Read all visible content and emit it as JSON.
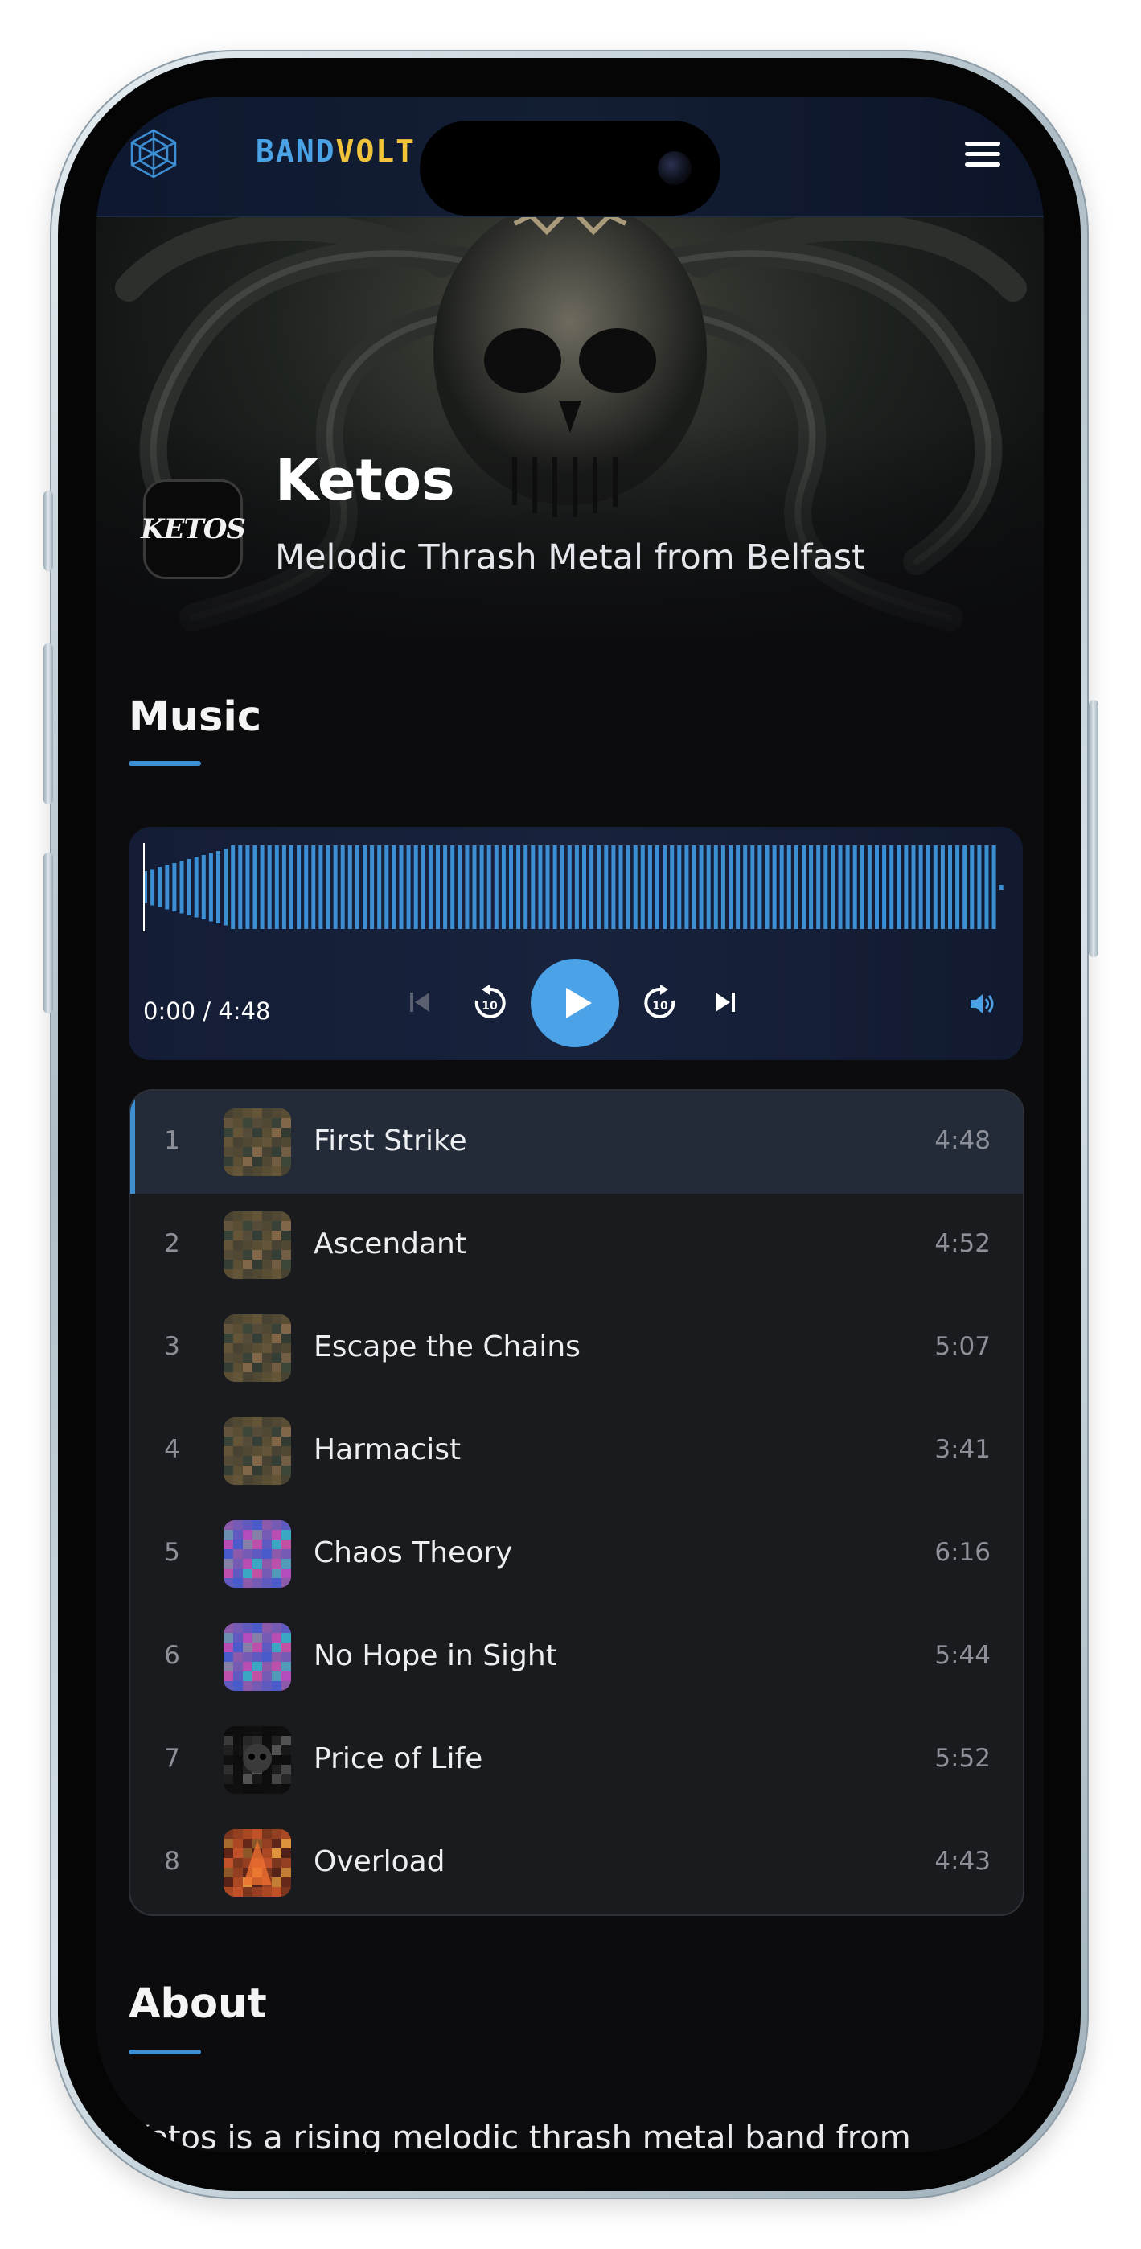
{
  "nav": {
    "brand_part1": "BAND",
    "brand_part2": "VOLT",
    "menu_icon": "hamburger-menu-icon",
    "logo_icon": "cube-logo-icon"
  },
  "hero": {
    "band_logo_text": "KETOS",
    "band_name": "Ketos",
    "tagline": "Melodic Thrash Metal from Belfast"
  },
  "music": {
    "title": "Music",
    "player": {
      "time_display": "0:00 / 4:48",
      "progress": 0,
      "icons": [
        "skip-back-icon",
        "rewind-10-icon",
        "play-icon",
        "forward-10-icon",
        "skip-forward-icon",
        "volume-icon"
      ]
    },
    "tracks": [
      {
        "num": "1",
        "title": "First Strike",
        "duration": "4:48",
        "active": true,
        "art": "album-a"
      },
      {
        "num": "2",
        "title": "Ascendant",
        "duration": "4:52",
        "active": false,
        "art": "album-a"
      },
      {
        "num": "3",
        "title": "Escape the Chains",
        "duration": "5:07",
        "active": false,
        "art": "album-a"
      },
      {
        "num": "4",
        "title": "Harmacist",
        "duration": "3:41",
        "active": false,
        "art": "album-a"
      },
      {
        "num": "5",
        "title": "Chaos Theory",
        "duration": "6:16",
        "active": false,
        "art": "album-b"
      },
      {
        "num": "6",
        "title": "No Hope in Sight",
        "duration": "5:44",
        "active": false,
        "art": "album-b"
      },
      {
        "num": "7",
        "title": "Price of Life",
        "duration": "5:52",
        "active": false,
        "art": "album-c"
      },
      {
        "num": "8",
        "title": "Overload",
        "duration": "4:43",
        "active": false,
        "art": "album-d"
      }
    ]
  },
  "about": {
    "title": "About",
    "text": "Ketos is a rising melodic thrash metal band from"
  },
  "colors": {
    "accent": "#4ba2e6",
    "brand_yellow": "#f3c43a",
    "background": "#0c0c0f"
  }
}
